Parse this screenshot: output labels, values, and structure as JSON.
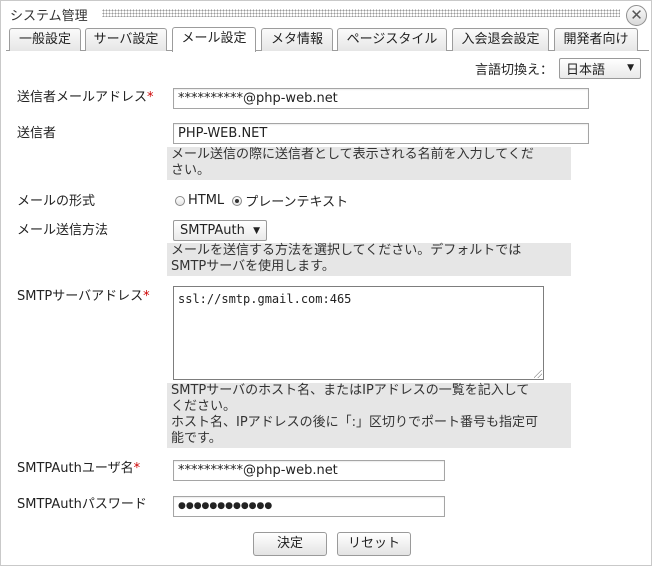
{
  "window": {
    "title": "システム管理",
    "close_glyph": "✕"
  },
  "tabs": [
    {
      "label": "一般設定",
      "active": false
    },
    {
      "label": "サーバ設定",
      "active": false
    },
    {
      "label": "メール設定",
      "active": true
    },
    {
      "label": "メタ情報",
      "active": false
    },
    {
      "label": "ページスタイル",
      "active": false
    },
    {
      "label": "入会退会設定",
      "active": false
    },
    {
      "label": "開発者向け",
      "active": false
    }
  ],
  "language": {
    "label": "言語切換え：",
    "selected": "日本語"
  },
  "form": {
    "sender_address": {
      "label": "送信者メールアドレス",
      "required_mark": "*",
      "value": "**********@php-web.net"
    },
    "sender_name": {
      "label": "送信者",
      "value": "PHP-WEB.NET",
      "help": [
        "メール送信の際に送信者として表示される名前を入力してくだ",
        "さい。"
      ]
    },
    "mail_format": {
      "label": "メールの形式",
      "options": [
        "HTML",
        "プレーンテキスト"
      ],
      "selected": "プレーンテキスト"
    },
    "send_method": {
      "label": "メール送信方法",
      "selected": "SMTPAuth",
      "help": [
        "メールを送信する方法を選択してください。デフォルトでは",
        "SMTPサーバを使用します。"
      ]
    },
    "smtp_address": {
      "label": "SMTPサーバアドレス",
      "required_mark": "*",
      "value": "ssl://smtp.gmail.com:465",
      "help": [
        "SMTPサーバのホスト名、またはIPアドレスの一覧を記入して",
        "ください。",
        "ホスト名、IPアドレスの後に「:」区切りでポート番号も指定可",
        "能です。"
      ]
    },
    "smtp_user": {
      "label": "SMTPAuthユーザ名",
      "required_mark": "*",
      "value": "**********@php-web.net"
    },
    "smtp_password": {
      "label": "SMTPAuthパスワード",
      "value": "●●●●●●●●●●●●"
    }
  },
  "buttons": {
    "submit": "決定",
    "reset": "リセット"
  },
  "colors": {
    "required": "#cc0000",
    "help_bg": "#e6e6e6"
  }
}
